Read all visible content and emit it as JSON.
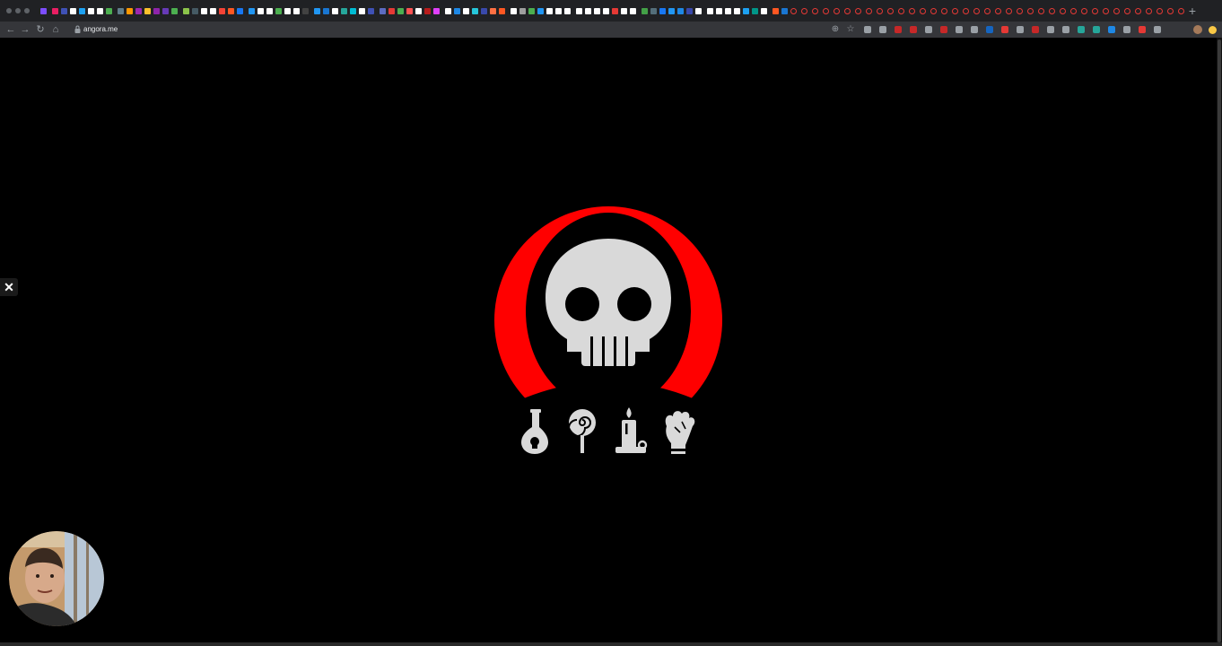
{
  "browser": {
    "address_bar": {
      "url": "angora.me"
    },
    "new_tab_label": "+",
    "toolbar": {
      "back": "←",
      "forward": "→",
      "reload": "↻",
      "home": "⌂"
    }
  },
  "overlay": {
    "close_label": "✕"
  },
  "logo": {
    "skull_icon": "skull-icon",
    "item_icons": [
      "potion-flask-icon",
      "lollipop-icon",
      "candle-icon",
      "zombie-hand-icon"
    ]
  },
  "colors": {
    "background": "#000000",
    "hood_red": "#ff0000",
    "icon_gray": "#d9d9d9",
    "chrome_dark": "#202124",
    "toolbar": "#35363a"
  }
}
